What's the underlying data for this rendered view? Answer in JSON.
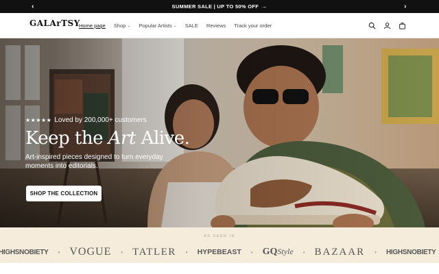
{
  "announcement": {
    "text": "SUMMER SALE | UP TO 50% OFF",
    "arrow": "→",
    "prev_icon": "chevron-left-icon",
    "next_icon": "chevron-right-icon"
  },
  "header": {
    "logo": "GALArTSY",
    "nav": [
      {
        "label": "Home page",
        "active": true
      },
      {
        "label": "Shop",
        "dropdown": true
      },
      {
        "label": "Popular Artists",
        "dropdown": true
      },
      {
        "label": "SALE"
      },
      {
        "label": "Reviews"
      },
      {
        "label": "Track your order"
      }
    ],
    "icons": [
      "search-icon",
      "account-icon",
      "cart-icon"
    ]
  },
  "hero": {
    "stars": "★★★★★",
    "rating_text": "Loved by 200,000+ customers",
    "headline_pre": "Keep the ",
    "headline_ital": "Art",
    "headline_post": " Alive.",
    "subtext": "Art-inspired pieces designed to turn everyday moments into editorials.",
    "cta": "SHOP THE COLLECTION"
  },
  "press": {
    "label": "AS SEEN IN",
    "brands": [
      "HIGHSNOBIETY",
      "VOGUE",
      "TATLER",
      "HYPEBEAST",
      "GQ",
      "Style",
      "BAZAAR",
      "HIGHSNOBIETY"
    ]
  },
  "colors": {
    "announcement_bg": "#111111",
    "press_bg": "#f5ecdc",
    "cta_bg": "#ffffff"
  }
}
